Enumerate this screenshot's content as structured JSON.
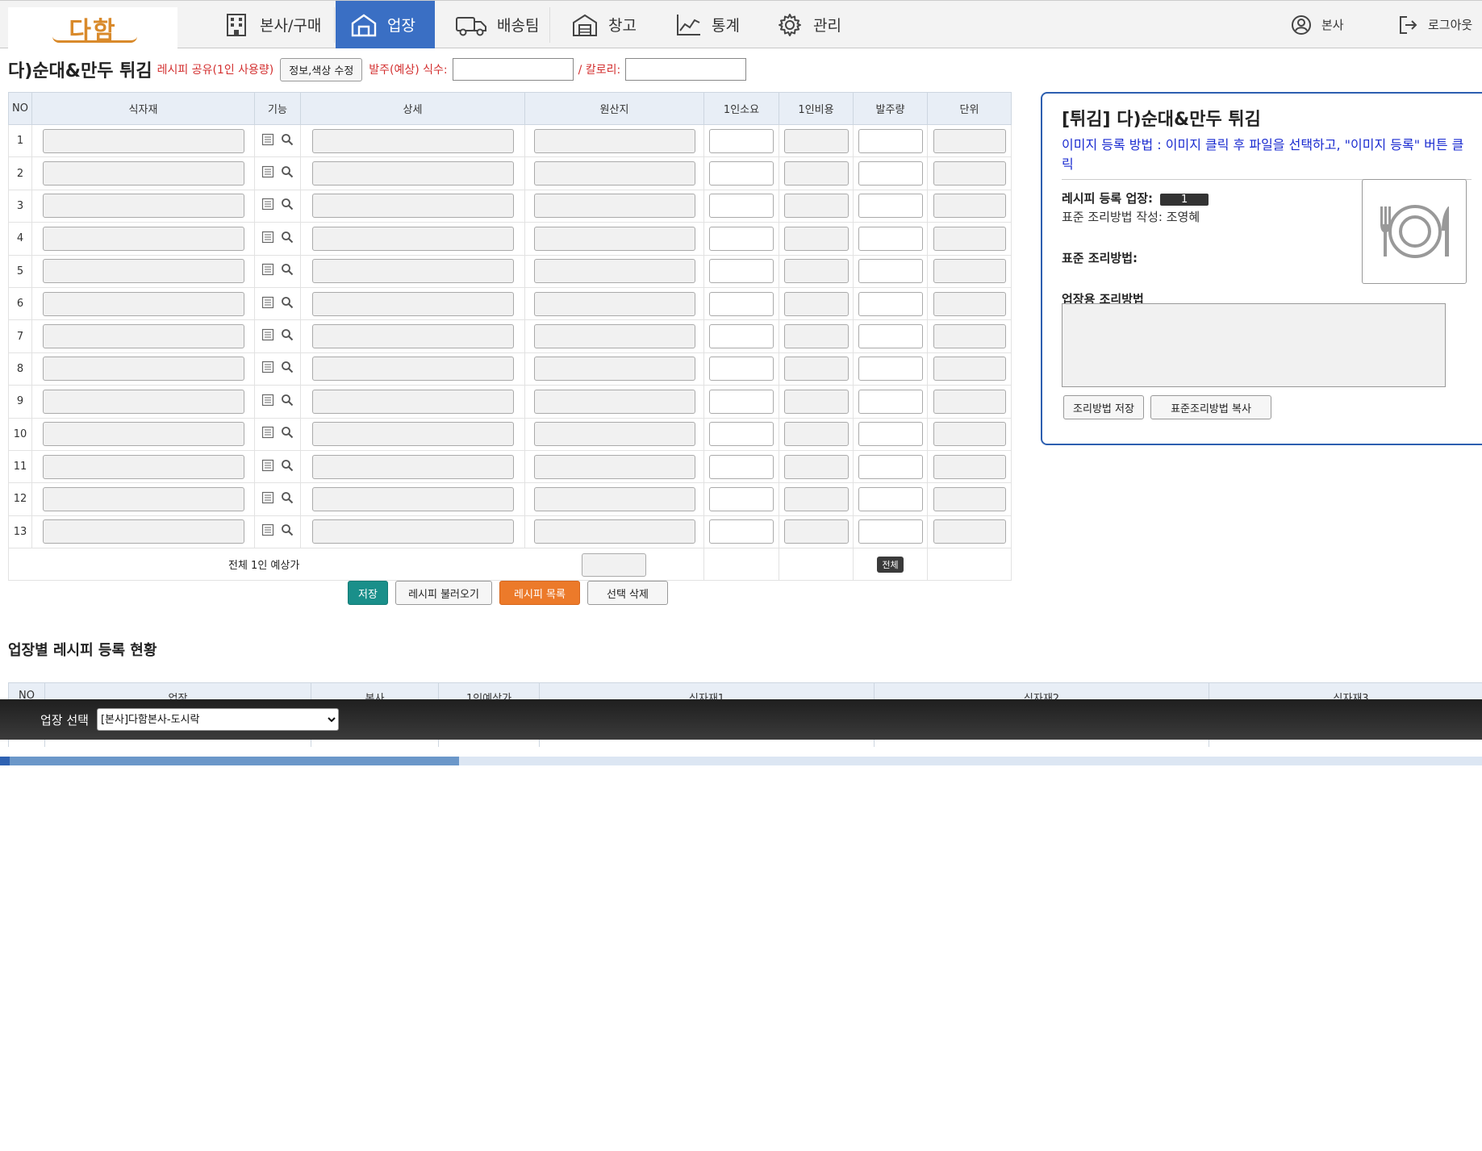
{
  "nav": {
    "logo_text": "다함",
    "items": [
      {
        "label": "본사/구매",
        "icon": "building-icon",
        "active": false
      },
      {
        "label": "업장",
        "icon": "store-icon",
        "active": true
      },
      {
        "label": "배송팀",
        "icon": "truck-icon",
        "active": false
      },
      {
        "label": "창고",
        "icon": "warehouse-icon",
        "active": false
      },
      {
        "label": "통계",
        "icon": "chart-icon",
        "active": false
      },
      {
        "label": "관리",
        "icon": "gear-icon",
        "active": false
      }
    ],
    "user_label": "본사",
    "logout_label": "로그아웃"
  },
  "header": {
    "title": "다)순대&만두 튀김",
    "share_note": "레시피 공유(1인 사용량)",
    "edit_button": "정보,색상 수정",
    "order_label": "발주(예상) 식수:",
    "order_value": "",
    "calorie_label": "/ 칼로리:",
    "calorie_value": ""
  },
  "grid": {
    "columns": [
      "NO",
      "식자재",
      "기능",
      "상세",
      "원산지",
      "1인소요",
      "1인비용",
      "발주량",
      "단위"
    ],
    "rows": [
      "1",
      "2",
      "3",
      "4",
      "5",
      "6",
      "7",
      "8",
      "9",
      "10",
      "11",
      "12",
      "13"
    ],
    "total_label": "전체 1인 예상가",
    "all_badge": "전체"
  },
  "actions": {
    "save": "저장",
    "load": "레시피 불러오기",
    "list": "레시피 목록",
    "delete": "선택 삭제"
  },
  "panel": {
    "title": "[튀김] 다)순대&만두 튀김",
    "image_help": "이미지 등록 방법 : 이미지 클릭 후 파일을 선택하고, \"이미지 등록\" 버튼 클릭",
    "register_label": "레시피 등록 업장:",
    "register_count": "1",
    "author_text": "표준 조리방법 작성: 조영혜",
    "standard_label": "표준 조리방법:",
    "store_method_label": "업장용 조리방법",
    "save_method": "조리방법 저장",
    "copy_method": "표준조리방법 복사"
  },
  "status": {
    "section_title": "업장별 레시피 등록 현황",
    "columns": [
      "NO",
      "업장",
      "본사",
      "1인예상가",
      "식자재1",
      "식자재2",
      "식자재3"
    ],
    "store_select_label": "업장 선택",
    "store_selected": "[본사]다함본사-도시락",
    "progress": 0.31
  }
}
